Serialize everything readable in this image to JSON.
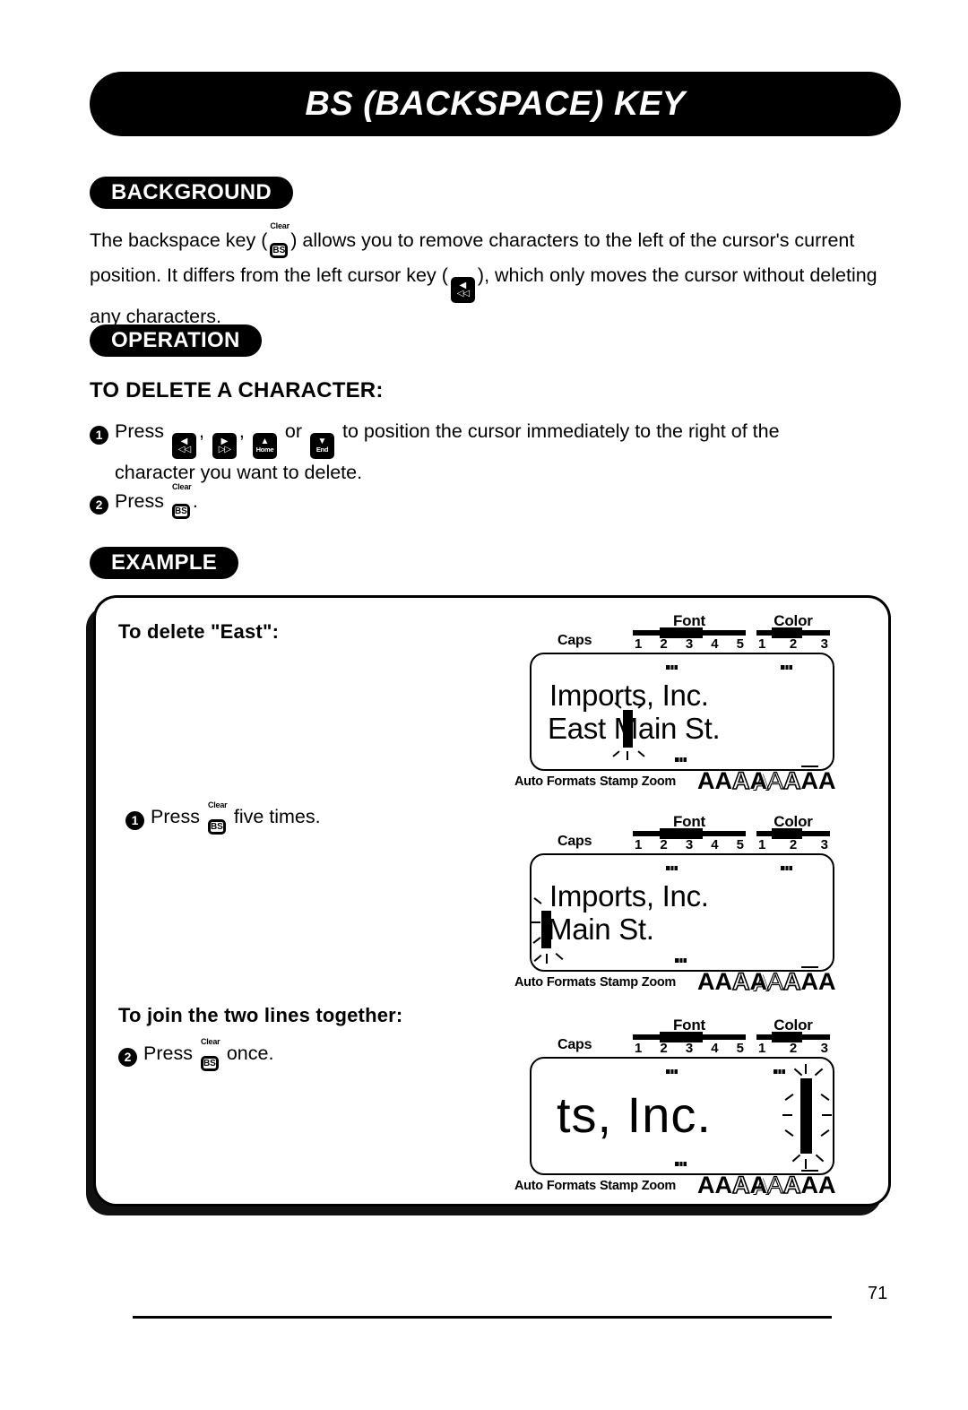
{
  "page": {
    "title": "BS (BACKSPACE) KEY",
    "number": "71"
  },
  "sections": {
    "background": {
      "label": "BACKGROUND",
      "paragraph_part1": "The backspace key (",
      "paragraph_part2": ") allows you to remove characters to the left of the cursor's current position.  It differs from the left cursor key (",
      "paragraph_part3": "), which only moves the cursor without deleting any characters."
    },
    "operation": {
      "label": "OPERATION",
      "subhead": "TO DELETE A CHARACTER:",
      "step1": {
        "num": "1",
        "press_label": "Press",
        "sep": ",",
        "or_label": "or",
        "text_after": "to position the cursor immediately to the right of the",
        "text_second_line": "character you want to delete."
      },
      "step2": {
        "num": "2",
        "press_label": "Press",
        "period": "."
      }
    },
    "example": {
      "label": "EXAMPLE",
      "heading1": "To delete \"East\":",
      "heading2": "To join the two lines together:",
      "step1": {
        "num": "1",
        "press_label": "Press",
        "after": "five times."
      },
      "step2": {
        "num": "2",
        "press_label": "Press",
        "after": "once."
      }
    }
  },
  "keys": {
    "bs": {
      "cap": "Clear",
      "face": "BS"
    },
    "left": {
      "top": "◀",
      "bottom": "◁◁"
    },
    "right": {
      "top": "▶",
      "bottom": "▷▷"
    },
    "home": {
      "top": "▲",
      "bottom": "Home"
    },
    "end": {
      "top": "▼",
      "bottom": "End"
    }
  },
  "lcd": {
    "labels": {
      "caps": "Caps",
      "font": "Font",
      "color": "Color",
      "font_nums": [
        "1",
        "2",
        "3",
        "4",
        "5"
      ],
      "color_nums": [
        "1",
        "2",
        "3"
      ],
      "status": [
        "Auto",
        "Formats",
        "Stamp",
        "Zoom"
      ]
    },
    "screens": [
      {
        "name": "before-delete",
        "line1": "Imports, Inc.",
        "line2_before_cursor": "East ",
        "line2_after_cursor": "Main St."
      },
      {
        "name": "after-five-backspaces",
        "line1": "Imports, Inc.",
        "line2_before_cursor": "",
        "line2_after_cursor": "Main St."
      },
      {
        "name": "after-join",
        "line1": "ts, Inc.",
        "line2_before_cursor": "",
        "line2_after_cursor": ""
      }
    ]
  }
}
